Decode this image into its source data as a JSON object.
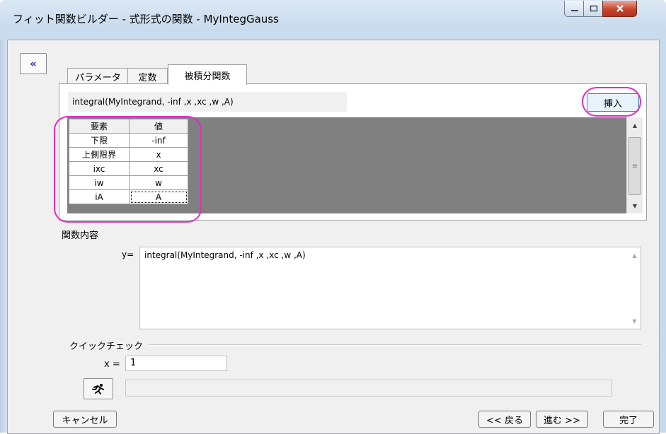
{
  "window": {
    "title": "フィット関数ビルダー - 式形式の関数 - MyIntegGauss",
    "minimize_icon": "minimize-icon",
    "maximize_icon": "maximize-icon",
    "close_icon": "close-icon"
  },
  "nav": {
    "collapse_label": "«"
  },
  "tabs": [
    {
      "label": "パラメータ",
      "selected": false
    },
    {
      "label": "定数",
      "selected": false
    },
    {
      "label": "被積分関数",
      "selected": true
    }
  ],
  "integrand": {
    "expression": "integral(MyIntegrand, -inf ,x ,xc ,w ,A)",
    "insert_label": "挿入",
    "grid": {
      "headers": [
        "要素",
        "値"
      ],
      "rows": [
        [
          "下限",
          "-inf"
        ],
        [
          "上側限界",
          "x"
        ],
        [
          "ixc",
          "xc"
        ],
        [
          "iw",
          "w"
        ],
        [
          "iA",
          "A"
        ]
      ]
    }
  },
  "function_content": {
    "label": "関数内容",
    "y_label": "y=",
    "text": "integral(MyIntegrand, -inf ,x ,xc ,w ,A)"
  },
  "quick_check": {
    "label": "クイックチェック",
    "x_label": "x =",
    "x_value": "1",
    "result": ""
  },
  "footer": {
    "cancel_label": "キャンセル",
    "back_label": "<< 戻る",
    "next_label": "進む >>",
    "finish_label": "完了"
  },
  "colors": {
    "highlight": "#e02dc4",
    "grid_background": "#808080",
    "collapse_arrow": "#2236c8"
  }
}
